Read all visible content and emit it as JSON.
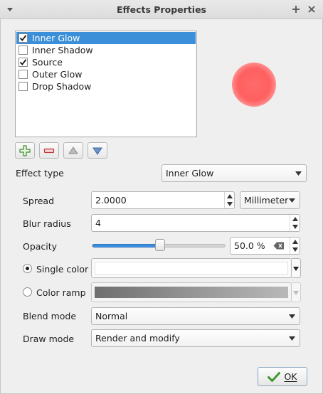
{
  "window": {
    "title": "Effects Properties",
    "menu_icon": "chevron-down-icon",
    "float_icon": "plus-icon",
    "close_icon": "close-icon"
  },
  "effects": [
    {
      "label": "Inner Glow",
      "checked": true,
      "selected": true
    },
    {
      "label": "Inner Shadow",
      "checked": false,
      "selected": false
    },
    {
      "label": "Source",
      "checked": true,
      "selected": false
    },
    {
      "label": "Outer Glow",
      "checked": false,
      "selected": false
    },
    {
      "label": "Drop Shadow",
      "checked": false,
      "selected": false
    }
  ],
  "preview": {
    "color": "#ff5f5f"
  },
  "toolbar": {
    "add_icon": "plus-icon",
    "remove_icon": "minus-icon",
    "up_icon": "arrow-up-icon",
    "down_icon": "arrow-down-icon"
  },
  "effect_type": {
    "label": "Effect type",
    "value": "Inner Glow"
  },
  "spread": {
    "label": "Spread",
    "value": "2.0000",
    "unit": "Millimeter"
  },
  "blur_radius": {
    "label": "Blur radius",
    "value": "4"
  },
  "opacity": {
    "label": "Opacity",
    "value": "50.0 %",
    "level": 0.5
  },
  "single_color": {
    "label": "Single color",
    "selected": true,
    "color": "#ffffff"
  },
  "color_ramp": {
    "label": "Color ramp",
    "selected": false
  },
  "blend_mode": {
    "label": "Blend mode",
    "value": "Normal"
  },
  "draw_mode": {
    "label": "Draw mode",
    "value": "Render and modify"
  },
  "ok": {
    "label": "OK"
  },
  "colors": {
    "selection": "#3a8fd8",
    "slider_fill": "#3d8ee0",
    "ok_check": "#3c9a2f"
  }
}
